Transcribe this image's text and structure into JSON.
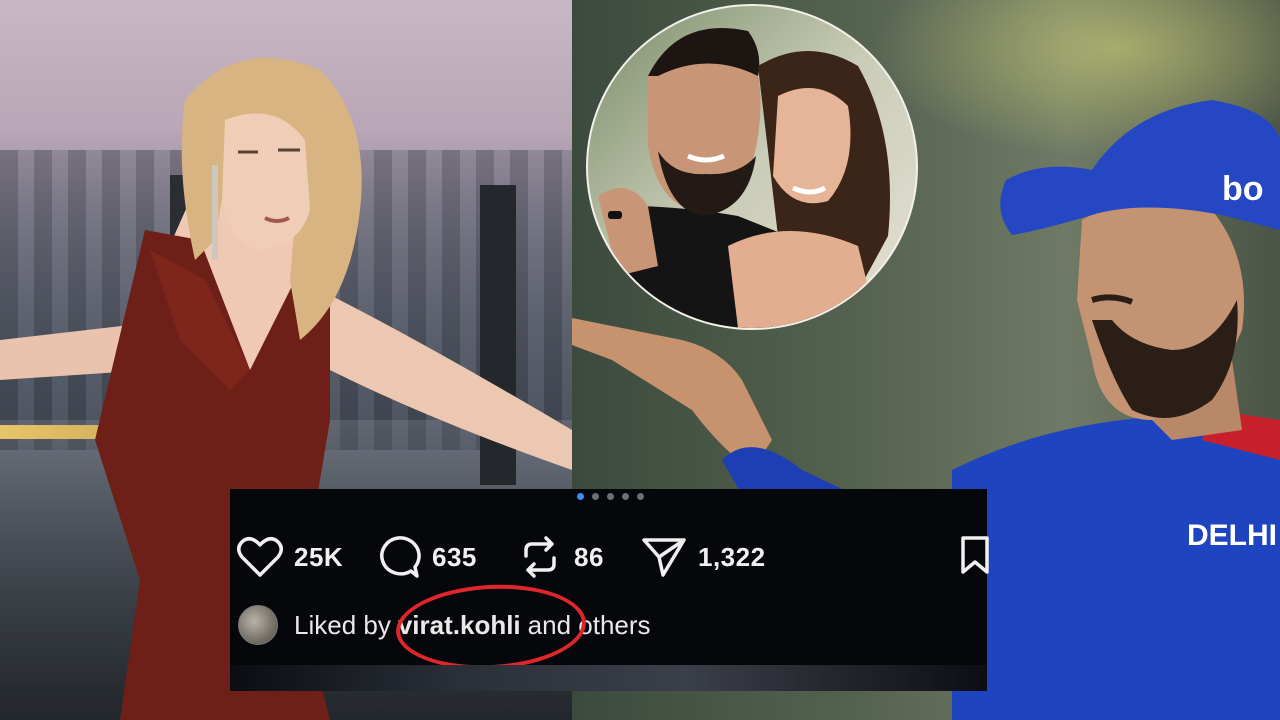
{
  "post": {
    "carousel_dots": 5,
    "active_dot": 0,
    "likes": "25K",
    "comments": "635",
    "reposts": "86",
    "shares": "1,322",
    "liked_by_prefix": "Liked by",
    "liked_by_user": "virat.kohli",
    "liked_by_suffix": "and others"
  },
  "icons": {
    "like": "heart-icon",
    "comment": "comment-bubble-icon",
    "repost": "repost-icon",
    "share": "send-icon",
    "bookmark": "bookmark-icon"
  },
  "photos": {
    "cap_text": "bo",
    "jersey_text": "DELHI"
  },
  "colors": {
    "highlight_circle": "#e0262a",
    "active_dot": "#3d8df5",
    "post_bg": "#05070b",
    "jersey": "#1d3fb3",
    "dress": "#6e1f17"
  }
}
